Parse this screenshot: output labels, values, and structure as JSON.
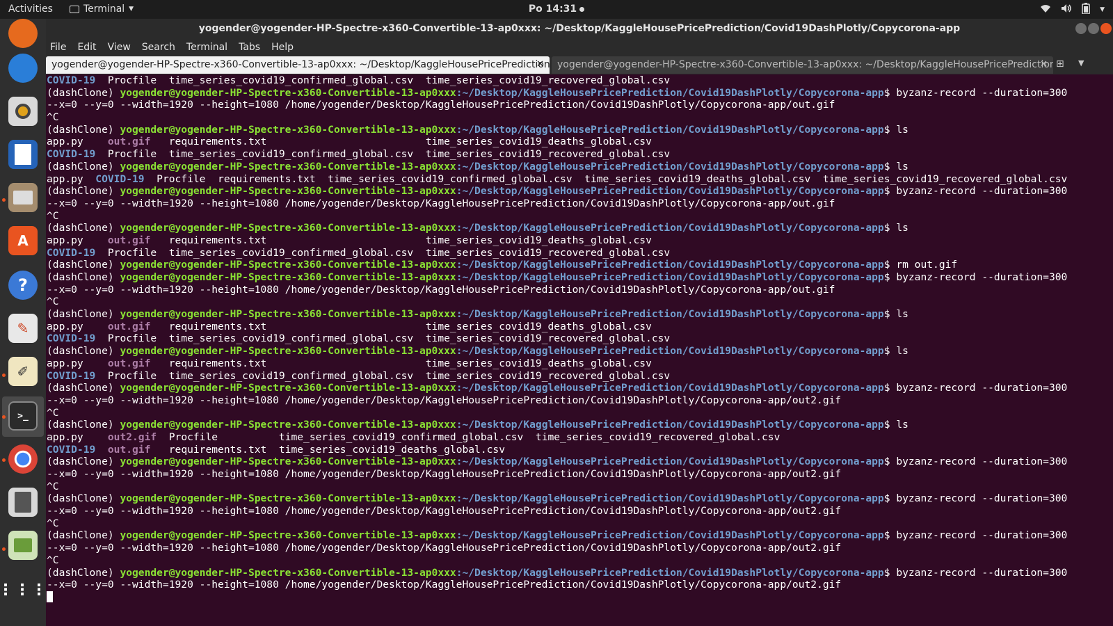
{
  "topbar": {
    "activities": "Activities",
    "app_name": "Terminal",
    "clock": "Po 14:31"
  },
  "window": {
    "title": "yogender@yogender-HP-Spectre-x360-Convertible-13-ap0xxx: ~/Desktop/KaggleHousePricePrediction/Covid19DashPlotly/Copycorona-app",
    "menu": [
      "File",
      "Edit",
      "View",
      "Search",
      "Terminal",
      "Tabs",
      "Help"
    ],
    "tabs": [
      {
        "label": "yogender@yogender-HP-Spectre-x360-Convertible-13-ap0xxx: ~/Desktop/KaggleHousePricePrediction...",
        "active": true
      },
      {
        "label": "yogender@yogender-HP-Spectre-x360-Convertible-13-ap0xxx: ~/Desktop/KaggleHousePricePrediction...",
        "active": false
      }
    ]
  },
  "colors": {
    "terminal_bg": "#300a24",
    "user_host": "#8ae234",
    "path": "#729fcf",
    "directory": "#729fcf",
    "gif_file": "#ad7fa8",
    "accent": "#e95420"
  },
  "dock_icons": [
    "firefox-icon",
    "thunderbird-icon",
    "rhythmbox-icon",
    "writer-icon",
    "files-icon",
    "software-icon",
    "help-icon",
    "document-viewer-icon",
    "text-editor-icon",
    "terminal-icon",
    "chrome-icon",
    "calculator-icon",
    "image-viewer-icon",
    "app-grid-icon"
  ],
  "terminal": {
    "env": "(dashClone) ",
    "user": "yogender@yogender-HP-Spectre-x360-Convertible-13-ap0xxx",
    "path": ":~/Desktop/KaggleHousePricePrediction/Covid19DashPlotly/Copycorona-app",
    "dollar": "$ ",
    "lines": [
      {
        "type": "out",
        "segs": [
          [
            "COVID-19",
            "d"
          ],
          [
            "  Procfile  time_series_covid19_confirmed_global.csv  time_series_covid19_recovered_global.csv",
            ""
          ]
        ]
      },
      {
        "type": "prompt",
        "cmd": "byzanz-record --duration=300"
      },
      {
        "type": "out",
        "segs": [
          [
            "--x=0 --y=0 --width=1920 --height=1080 /home/yogender/Desktop/KaggleHousePricePrediction/Covid19DashPlotly/Copycorona-app/out.gif",
            ""
          ]
        ]
      },
      {
        "type": "out",
        "segs": [
          [
            "^C",
            ""
          ]
        ]
      },
      {
        "type": "prompt",
        "cmd": "ls"
      },
      {
        "type": "out",
        "segs": [
          [
            "app.py    ",
            ""
          ],
          [
            "out.gif",
            "g"
          ],
          [
            "   requirements.txt                          time_series_covid19_deaths_global.csv",
            ""
          ]
        ]
      },
      {
        "type": "out",
        "segs": [
          [
            "COVID-19",
            "d"
          ],
          [
            "  Procfile  time_series_covid19_confirmed_global.csv  time_series_covid19_recovered_global.csv",
            ""
          ]
        ]
      },
      {
        "type": "prompt",
        "cmd": "ls"
      },
      {
        "type": "out",
        "segs": [
          [
            "app.py  ",
            ""
          ],
          [
            "COVID-19",
            "d"
          ],
          [
            "  Procfile  requirements.txt  time_series_covid19_confirmed_global.csv  time_series_covid19_deaths_global.csv  time_series_covid19_recovered_global.csv",
            ""
          ]
        ]
      },
      {
        "type": "prompt",
        "cmd": "byzanz-record --duration=300"
      },
      {
        "type": "out",
        "segs": [
          [
            "--x=0 --y=0 --width=1920 --height=1080 /home/yogender/Desktop/KaggleHousePricePrediction/Covid19DashPlotly/Copycorona-app/out.gif",
            ""
          ]
        ]
      },
      {
        "type": "out",
        "segs": [
          [
            "^C",
            ""
          ]
        ]
      },
      {
        "type": "prompt",
        "cmd": "ls"
      },
      {
        "type": "out",
        "segs": [
          [
            "app.py    ",
            ""
          ],
          [
            "out.gif",
            "g"
          ],
          [
            "   requirements.txt                          time_series_covid19_deaths_global.csv",
            ""
          ]
        ]
      },
      {
        "type": "out",
        "segs": [
          [
            "COVID-19",
            "d"
          ],
          [
            "  Procfile  time_series_covid19_confirmed_global.csv  time_series_covid19_recovered_global.csv",
            ""
          ]
        ]
      },
      {
        "type": "prompt",
        "cmd": "rm out.gif"
      },
      {
        "type": "prompt",
        "cmd": "byzanz-record --duration=300"
      },
      {
        "type": "out",
        "segs": [
          [
            "--x=0 --y=0 --width=1920 --height=1080 /home/yogender/Desktop/KaggleHousePricePrediction/Covid19DashPlotly/Copycorona-app/out.gif",
            ""
          ]
        ]
      },
      {
        "type": "out",
        "segs": [
          [
            "^C",
            ""
          ]
        ]
      },
      {
        "type": "prompt",
        "cmd": "ls"
      },
      {
        "type": "out",
        "segs": [
          [
            "app.py    ",
            ""
          ],
          [
            "out.gif",
            "g"
          ],
          [
            "   requirements.txt                          time_series_covid19_deaths_global.csv",
            ""
          ]
        ]
      },
      {
        "type": "out",
        "segs": [
          [
            "COVID-19",
            "d"
          ],
          [
            "  Procfile  time_series_covid19_confirmed_global.csv  time_series_covid19_recovered_global.csv",
            ""
          ]
        ]
      },
      {
        "type": "prompt",
        "cmd": "ls"
      },
      {
        "type": "out",
        "segs": [
          [
            "app.py    ",
            ""
          ],
          [
            "out.gif",
            "g"
          ],
          [
            "   requirements.txt                          time_series_covid19_deaths_global.csv",
            ""
          ]
        ]
      },
      {
        "type": "out",
        "segs": [
          [
            "COVID-19",
            "d"
          ],
          [
            "  Procfile  time_series_covid19_confirmed_global.csv  time_series_covid19_recovered_global.csv",
            ""
          ]
        ]
      },
      {
        "type": "prompt",
        "cmd": "byzanz-record --duration=300"
      },
      {
        "type": "out",
        "segs": [
          [
            "--x=0 --y=0 --width=1920 --height=1080 /home/yogender/Desktop/KaggleHousePricePrediction/Covid19DashPlotly/Copycorona-app/out2.gif",
            ""
          ]
        ]
      },
      {
        "type": "out",
        "segs": [
          [
            "^C",
            ""
          ]
        ]
      },
      {
        "type": "prompt",
        "cmd": "ls"
      },
      {
        "type": "out",
        "segs": [
          [
            "app.py    ",
            ""
          ],
          [
            "out2.gif",
            "g"
          ],
          [
            "  Procfile          time_series_covid19_confirmed_global.csv  time_series_covid19_recovered_global.csv",
            ""
          ]
        ]
      },
      {
        "type": "out",
        "segs": [
          [
            "COVID-19",
            "d"
          ],
          [
            "  ",
            ""
          ],
          [
            "out.gif",
            "g"
          ],
          [
            "   requirements.txt  time_series_covid19_deaths_global.csv",
            ""
          ]
        ]
      },
      {
        "type": "prompt",
        "cmd": "byzanz-record --duration=300"
      },
      {
        "type": "out",
        "segs": [
          [
            "--x=0 --y=0 --width=1920 --height=1080 /home/yogender/Desktop/KaggleHousePricePrediction/Covid19DashPlotly/Copycorona-app/out2.gif",
            ""
          ]
        ]
      },
      {
        "type": "out",
        "segs": [
          [
            "^C",
            ""
          ]
        ]
      },
      {
        "type": "prompt",
        "cmd": "byzanz-record --duration=300"
      },
      {
        "type": "out",
        "segs": [
          [
            "--x=0 --y=0 --width=1920 --height=1080 /home/yogender/Desktop/KaggleHousePricePrediction/Covid19DashPlotly/Copycorona-app/out2.gif",
            ""
          ]
        ]
      },
      {
        "type": "out",
        "segs": [
          [
            "^C",
            ""
          ]
        ]
      },
      {
        "type": "prompt",
        "cmd": "byzanz-record --duration=300"
      },
      {
        "type": "out",
        "segs": [
          [
            "--x=0 --y=0 --width=1920 --height=1080 /home/yogender/Desktop/KaggleHousePricePrediction/Covid19DashPlotly/Copycorona-app/out2.gif",
            ""
          ]
        ]
      },
      {
        "type": "out",
        "segs": [
          [
            "^C",
            ""
          ]
        ]
      },
      {
        "type": "prompt",
        "cmd": "byzanz-record --duration=300"
      },
      {
        "type": "out",
        "segs": [
          [
            "--x=0 --y=0 --width=1920 --height=1080 /home/yogender/Desktop/KaggleHousePricePrediction/Covid19DashPlotly/Copycorona-app/out2.gif",
            ""
          ]
        ]
      },
      {
        "type": "cursor"
      }
    ]
  }
}
